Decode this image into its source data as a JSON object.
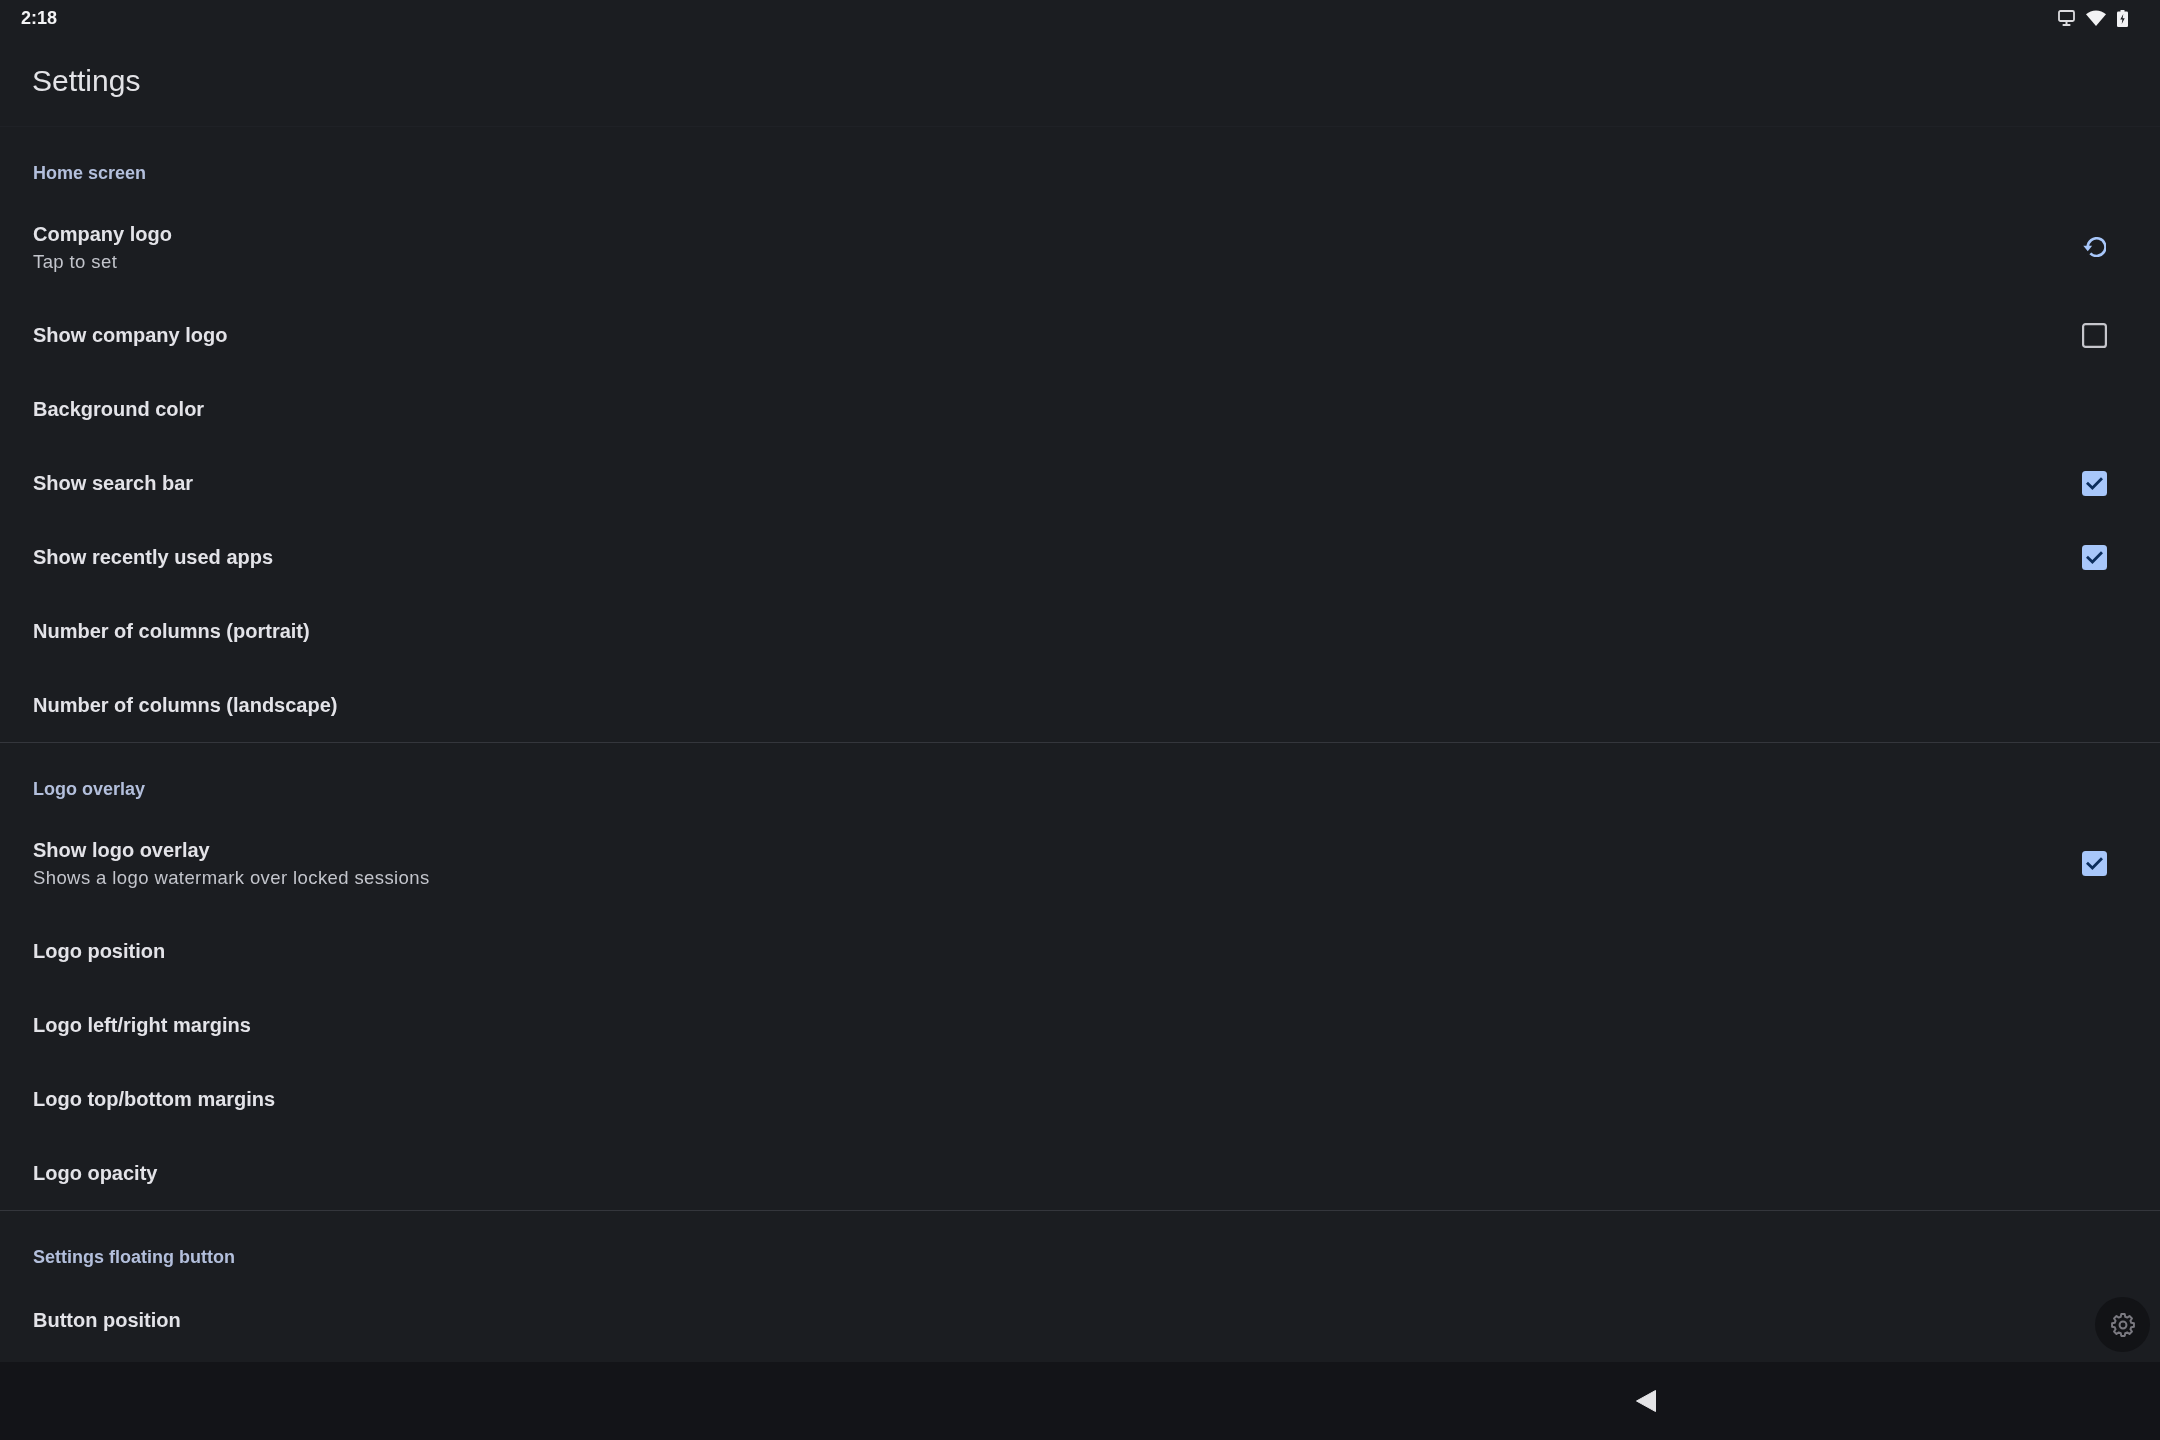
{
  "status_bar": {
    "time": "2:18"
  },
  "app_bar": {
    "title": "Settings"
  },
  "sections": [
    {
      "header": "Home screen",
      "items": [
        {
          "kind": "reset",
          "title": "Company logo",
          "summary": "Tap to set"
        },
        {
          "kind": "checkbox",
          "title": "Show company logo",
          "checked": false
        },
        {
          "kind": "plain",
          "title": "Background color"
        },
        {
          "kind": "checkbox",
          "title": "Show search bar",
          "checked": true
        },
        {
          "kind": "checkbox",
          "title": "Show recently used apps",
          "checked": true
        },
        {
          "kind": "plain",
          "title": "Number of columns (portrait)"
        },
        {
          "kind": "plain",
          "title": "Number of columns (landscape)"
        }
      ]
    },
    {
      "header": "Logo overlay",
      "items": [
        {
          "kind": "checkbox",
          "title": "Show logo overlay",
          "summary": "Shows a logo watermark over locked sessions",
          "checked": true
        },
        {
          "kind": "plain",
          "title": "Logo position"
        },
        {
          "kind": "plain",
          "title": "Logo left/right margins"
        },
        {
          "kind": "plain",
          "title": "Logo top/bottom margins"
        },
        {
          "kind": "plain",
          "title": "Logo opacity"
        }
      ]
    },
    {
      "header": "Settings floating button",
      "items": [
        {
          "kind": "plain",
          "title": "Button position"
        }
      ]
    }
  ]
}
